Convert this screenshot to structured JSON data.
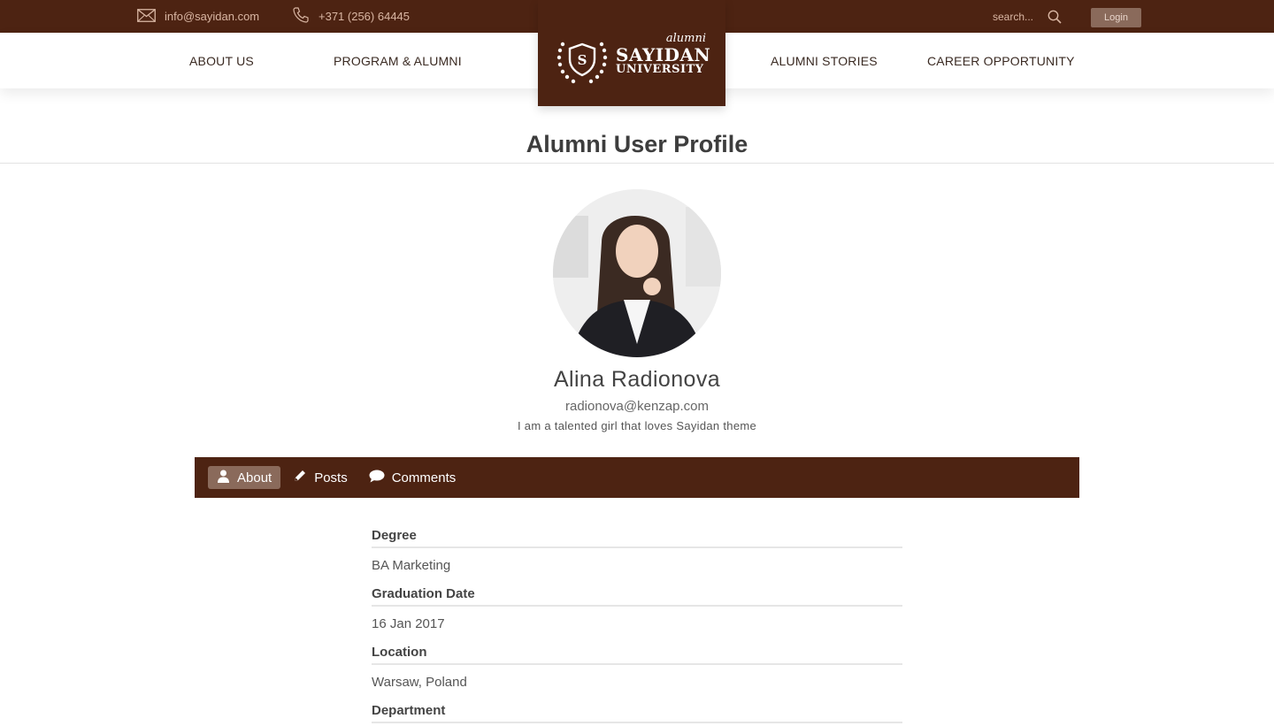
{
  "topbar": {
    "email": "info@sayidan.com",
    "phone": "+371 (256) 64445",
    "search_placeholder": "search...",
    "login_label": "Login"
  },
  "nav": {
    "items": [
      "ABOUT US",
      "PROGRAM & ALUMNI",
      "ALUMNI STORIES",
      "CAREER OPPORTUNITY"
    ]
  },
  "logo": {
    "tag": "alumni",
    "name": "SAYIDAN",
    "sub": "UNIVERSITY"
  },
  "page": {
    "title": "Alumni User Profile"
  },
  "profile": {
    "name": "Alina Radionova",
    "email": "radionova@kenzap.com",
    "bio": "I am a talented girl that loves Sayidan theme"
  },
  "tabs": [
    {
      "label": "About",
      "icon": "user-icon",
      "active": true
    },
    {
      "label": "Posts",
      "icon": "pencil-icon",
      "active": false
    },
    {
      "label": "Comments",
      "icon": "comment-icon",
      "active": false
    }
  ],
  "about": {
    "fields": [
      {
        "label": "Degree",
        "value": "BA Marketing"
      },
      {
        "label": "Graduation Date",
        "value": "16 Jan 2017"
      },
      {
        "label": "Location",
        "value": "Warsaw, Poland"
      },
      {
        "label": "Department",
        "value": ""
      }
    ]
  },
  "colors": {
    "brand_brown": "#4d2312",
    "accent_muted": "#8a6a5b",
    "topbar_text": "#d9b6a3"
  }
}
